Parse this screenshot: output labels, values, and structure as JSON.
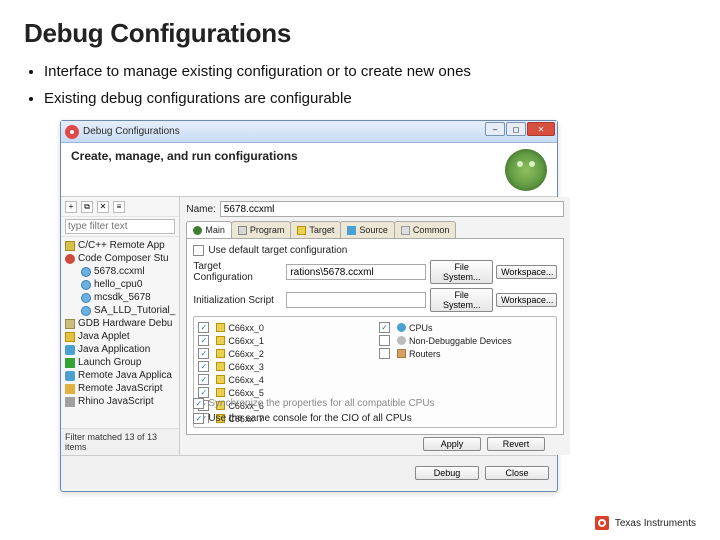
{
  "slide": {
    "title": "Debug Configurations",
    "bullet1": "Interface to manage existing configuration or to create new ones",
    "bullet2": "Existing debug configurations are configurable"
  },
  "dialog": {
    "title": "Debug Configurations",
    "headerTitle": "Create, manage, and run configurations",
    "filterPlaceholder": "type filter text",
    "tree": [
      {
        "icon": "c",
        "label": "C/C++ Remote App"
      },
      {
        "icon": "ccs",
        "label": "Code Composer Stu"
      },
      {
        "icon": "cfg",
        "label": "5678.ccxml",
        "indent": true
      },
      {
        "icon": "cfg",
        "label": "hello_cpu0",
        "indent": true
      },
      {
        "icon": "cfg",
        "label": "mcsdk_5678",
        "indent": true
      },
      {
        "icon": "cfg",
        "label": "SA_LLD_Tutorial_",
        "indent": true
      },
      {
        "icon": "gdb",
        "label": "GDB Hardware Debu"
      },
      {
        "icon": "j",
        "label": "Java Applet"
      },
      {
        "icon": "jar",
        "label": "Java Application"
      },
      {
        "icon": "play",
        "label": "Launch Group"
      },
      {
        "icon": "jar",
        "label": "Remote Java Applica"
      },
      {
        "icon": "js",
        "label": "Remote JavaScript"
      },
      {
        "icon": "rhino",
        "label": "Rhino JavaScript"
      }
    ],
    "matchText": "Filter matched 13 of 13 items",
    "nameLabel": "Name:",
    "nameValue": "5678.ccxml",
    "tabs": {
      "main": "Main",
      "program": "Program",
      "target": "Target",
      "source": "Source",
      "common": "Common"
    },
    "main": {
      "useDefault": "Use default target configuration",
      "targetCfgLabel": "Target Configuration",
      "targetCfgValue": "rations\\5678.ccxml",
      "fileSystemBtn": "File System...",
      "workspaceBtn": "Workspace...",
      "initScriptLabel": "Initialization Script",
      "cpus": [
        {
          "label": "C66xx_0",
          "checked": true
        },
        {
          "label": "C66xx_1",
          "checked": true
        },
        {
          "label": "C66xx_2",
          "checked": true
        },
        {
          "label": "C66xx_3",
          "checked": true
        },
        {
          "label": "C66xx_4",
          "checked": true
        },
        {
          "label": "C66xx_5",
          "checked": true
        },
        {
          "label": "C66xx_6",
          "checked": true
        },
        {
          "label": "C66xx_7",
          "checked": true
        }
      ],
      "rightCol": [
        {
          "label": "CPUs",
          "icon": "parent",
          "checked": true
        },
        {
          "label": "Non-Debuggable Devices",
          "icon": "ghost",
          "checked": false
        },
        {
          "label": "Routers",
          "icon": "router",
          "checked": false
        }
      ],
      "syncText": "Synchronize the properties for all compatible CPUs",
      "consoleText": "Use the same console for the CIO of all CPUs"
    },
    "buttons": {
      "apply": "Apply",
      "revert": "Revert",
      "debug": "Debug",
      "close": "Close"
    }
  },
  "credit": {
    "brand": "Texas Instruments"
  }
}
